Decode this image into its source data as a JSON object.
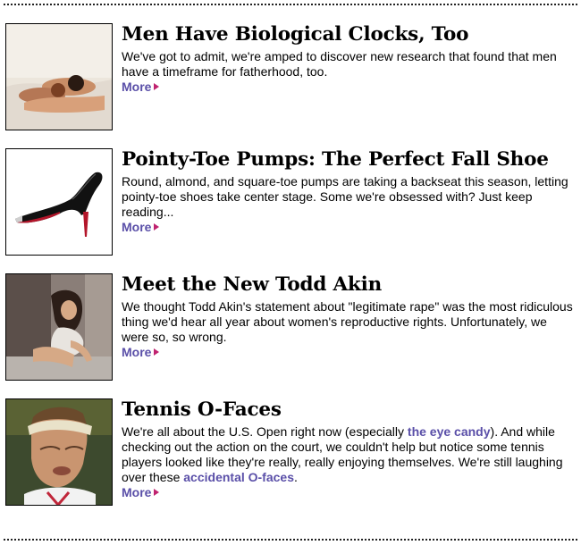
{
  "stories": [
    {
      "title": "Men Have Biological Clocks, Too",
      "description": "We've got to admit, we're amped to discover new research that found that men have a timeframe for fatherhood, too.",
      "more_label": "More",
      "arrow_icon": "triangle-right-icon"
    },
    {
      "title": "Pointy-Toe Pumps: The Perfect Fall Shoe",
      "description": "Round, almond, and square-toe pumps are taking a backseat this season, letting pointy-toe shoes take center stage. Some we're obsessed with? Just keep reading...",
      "more_label": "More",
      "arrow_icon": "triangle-right-icon"
    },
    {
      "title": "Meet the New Todd Akin",
      "description": "We thought Todd Akin's statement about \"legitimate rape\" was the most ridiculous thing we'd hear all year about women's reproductive rights. Unfortunately, we were so, so wrong.",
      "more_label": "More",
      "arrow_icon": "triangle-right-icon"
    },
    {
      "title": "Tennis O-Faces",
      "description_part1": "We're all about the U.S. Open right now (especially ",
      "link1": "the eye candy",
      "description_part2": "). And while checking out the action on the court, we couldn't help but notice some tennis players looked like they're really, really enjoying themselves. We're still laughing over these ",
      "link2": "accidental O-faces",
      "description_part3": ".",
      "more_label": "More",
      "arrow_icon": "triangle-right-icon"
    }
  ],
  "colors": {
    "link": "#5a4fa8",
    "arrow": "#c0226f",
    "rule": "#222222"
  }
}
